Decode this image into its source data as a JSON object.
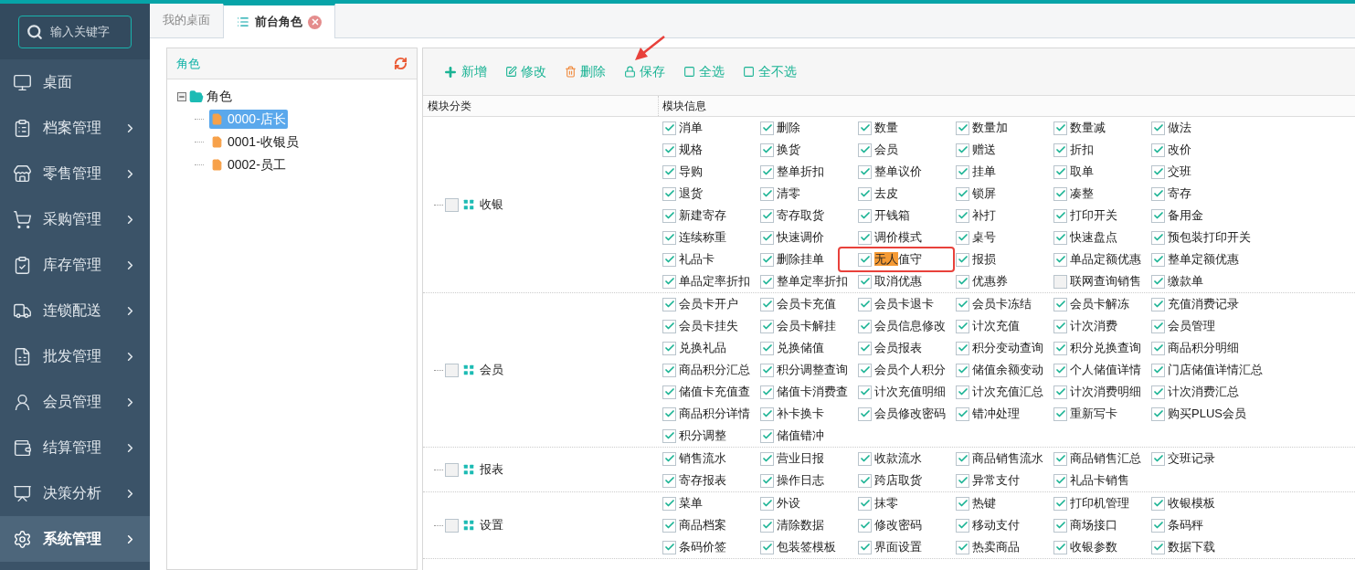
{
  "search": {
    "placeholder": "输入关键字"
  },
  "sidebar": {
    "items": [
      {
        "label": "桌面",
        "has_submenu": false,
        "selected": false
      },
      {
        "label": "档案管理",
        "has_submenu": true,
        "selected": false
      },
      {
        "label": "零售管理",
        "has_submenu": true,
        "selected": false
      },
      {
        "label": "采购管理",
        "has_submenu": true,
        "selected": false
      },
      {
        "label": "库存管理",
        "has_submenu": true,
        "selected": false
      },
      {
        "label": "连锁配送",
        "has_submenu": true,
        "selected": false
      },
      {
        "label": "批发管理",
        "has_submenu": true,
        "selected": false
      },
      {
        "label": "会员管理",
        "has_submenu": true,
        "selected": false
      },
      {
        "label": "结算管理",
        "has_submenu": true,
        "selected": false
      },
      {
        "label": "决策分析",
        "has_submenu": true,
        "selected": false
      },
      {
        "label": "系统管理",
        "has_submenu": true,
        "selected": true
      }
    ]
  },
  "tabs": [
    {
      "label": "我的桌面",
      "selected": false,
      "closable": false
    },
    {
      "label": "前台角色",
      "selected": true,
      "closable": true
    }
  ],
  "role_panel": {
    "title": "角色",
    "tree": {
      "label": "角色",
      "expanded": true,
      "children": [
        {
          "label": "0000-店长",
          "selected": true
        },
        {
          "label": "0001-收银员",
          "selected": false
        },
        {
          "label": "0002-员工",
          "selected": false
        }
      ]
    }
  },
  "toolbar": [
    {
      "label": "新增",
      "kind": "add",
      "annotated": false
    },
    {
      "label": "修改",
      "kind": "edit",
      "annotated": false
    },
    {
      "label": "删除",
      "kind": "delete",
      "annotated": false
    },
    {
      "label": "保存",
      "kind": "save",
      "annotated": true
    },
    {
      "label": "全选",
      "kind": "select",
      "annotated": false
    },
    {
      "label": "全不选",
      "kind": "select",
      "annotated": false
    }
  ],
  "table": {
    "columns": [
      "模块分类",
      "模块信息"
    ],
    "groups": [
      {
        "category": "收银",
        "checked": false,
        "permissions": [
          {
            "label": "消单",
            "checked": true
          },
          {
            "label": "删除",
            "checked": true
          },
          {
            "label": "数量",
            "checked": true
          },
          {
            "label": "数量加",
            "checked": true
          },
          {
            "label": "数量减",
            "checked": true
          },
          {
            "label": "做法",
            "checked": true
          },
          {
            "label": "规格",
            "checked": true
          },
          {
            "label": "换货",
            "checked": true
          },
          {
            "label": "会员",
            "checked": true
          },
          {
            "label": "赠送",
            "checked": true
          },
          {
            "label": "折扣",
            "checked": true
          },
          {
            "label": "改价",
            "checked": true
          },
          {
            "label": "导购",
            "checked": true
          },
          {
            "label": "整单折扣",
            "checked": true
          },
          {
            "label": "整单议价",
            "checked": true
          },
          {
            "label": "挂单",
            "checked": true
          },
          {
            "label": "取单",
            "checked": true
          },
          {
            "label": "交班",
            "checked": true
          },
          {
            "label": "退货",
            "checked": true
          },
          {
            "label": "清零",
            "checked": true
          },
          {
            "label": "去皮",
            "checked": true
          },
          {
            "label": "锁屏",
            "checked": true
          },
          {
            "label": "凑整",
            "checked": true
          },
          {
            "label": "寄存",
            "checked": true
          },
          {
            "label": "新建寄存",
            "checked": true
          },
          {
            "label": "寄存取货",
            "checked": true
          },
          {
            "label": "开钱箱",
            "checked": true
          },
          {
            "label": "补打",
            "checked": true
          },
          {
            "label": "打印开关",
            "checked": true
          },
          {
            "label": "备用金",
            "checked": true
          },
          {
            "label": "连续称重",
            "checked": true
          },
          {
            "label": "快速调价",
            "checked": true
          },
          {
            "label": "调价模式",
            "checked": true
          },
          {
            "label": "桌号",
            "checked": true
          },
          {
            "label": "快速盘点",
            "checked": true
          },
          {
            "label": "预包装打印开关",
            "checked": true
          },
          {
            "label": "礼品卡",
            "checked": true
          },
          {
            "label": "删除挂单",
            "checked": true
          },
          {
            "checked": true,
            "annotated": true,
            "label_parts": [
              {
                "text": "无人",
                "highlighted": true
              },
              {
                "text": "值守",
                "highlighted": false
              }
            ]
          },
          {
            "label": "报损",
            "checked": true
          },
          {
            "label": "单品定额优惠",
            "checked": true
          },
          {
            "label": "整单定额优惠",
            "checked": true
          },
          {
            "label": "单品定率折扣",
            "checked": true
          },
          {
            "label": "整单定率折扣",
            "checked": true
          },
          {
            "label": "取消优惠",
            "checked": true
          },
          {
            "label": "优惠券",
            "checked": true
          },
          {
            "label": "联网查询销售",
            "checked": false
          },
          {
            "label": "缴款单",
            "checked": true
          }
        ]
      },
      {
        "category": "会员",
        "checked": false,
        "permissions": [
          {
            "label": "会员卡开户",
            "checked": true
          },
          {
            "label": "会员卡充值",
            "checked": true
          },
          {
            "label": "会员卡退卡",
            "checked": true
          },
          {
            "label": "会员卡冻结",
            "checked": true
          },
          {
            "label": "会员卡解冻",
            "checked": true
          },
          {
            "label": "充值消费记录",
            "checked": true
          },
          {
            "label": "会员卡挂失",
            "checked": true
          },
          {
            "label": "会员卡解挂",
            "checked": true
          },
          {
            "label": "会员信息修改",
            "checked": true
          },
          {
            "label": "计次充值",
            "checked": true
          },
          {
            "label": "计次消费",
            "checked": true
          },
          {
            "label": "会员管理",
            "checked": true
          },
          {
            "label": "兑换礼品",
            "checked": true
          },
          {
            "label": "兑换储值",
            "checked": true
          },
          {
            "label": "会员报表",
            "checked": true
          },
          {
            "label": "积分变动查询",
            "checked": true
          },
          {
            "label": "积分兑换查询",
            "checked": true
          },
          {
            "label": "商品积分明细",
            "checked": true
          },
          {
            "label": "商品积分汇总",
            "checked": true
          },
          {
            "label": "积分调整查询",
            "checked": true
          },
          {
            "label": "会员个人积分",
            "checked": true
          },
          {
            "label": "储值余额变动",
            "checked": true
          },
          {
            "label": "个人储值详情",
            "checked": true
          },
          {
            "label": "门店储值详情汇总",
            "checked": true
          },
          {
            "label": "储值卡充值查",
            "checked": true
          },
          {
            "label": "储值卡消费查",
            "checked": true
          },
          {
            "label": "计次充值明细",
            "checked": true
          },
          {
            "label": "计次充值汇总",
            "checked": true
          },
          {
            "label": "计次消费明细",
            "checked": true
          },
          {
            "label": "计次消费汇总",
            "checked": true
          },
          {
            "label": "商品积分详情",
            "checked": true
          },
          {
            "label": "补卡换卡",
            "checked": true
          },
          {
            "label": "会员修改密码",
            "checked": true
          },
          {
            "label": "错冲处理",
            "checked": true
          },
          {
            "label": "重新写卡",
            "checked": true
          },
          {
            "label": "购买PLUS会员",
            "checked": true
          },
          {
            "label": "积分调整",
            "checked": true
          },
          {
            "label": "储值错冲",
            "checked": true
          }
        ]
      },
      {
        "category": "报表",
        "checked": false,
        "permissions": [
          {
            "label": "销售流水",
            "checked": true
          },
          {
            "label": "营业日报",
            "checked": true
          },
          {
            "label": "收款流水",
            "checked": true
          },
          {
            "label": "商品销售流水",
            "checked": true
          },
          {
            "label": "商品销售汇总",
            "checked": true
          },
          {
            "label": "交班记录",
            "checked": true
          },
          {
            "label": "寄存报表",
            "checked": true
          },
          {
            "label": "操作日志",
            "checked": true
          },
          {
            "label": "跨店取货",
            "checked": true
          },
          {
            "label": "异常支付",
            "checked": true
          },
          {
            "label": "礼品卡销售",
            "checked": true
          }
        ]
      },
      {
        "category": "设置",
        "checked": false,
        "permissions": [
          {
            "label": "菜单",
            "checked": true
          },
          {
            "label": "外设",
            "checked": true
          },
          {
            "label": "抹零",
            "checked": true
          },
          {
            "label": "热键",
            "checked": true
          },
          {
            "label": "打印机管理",
            "checked": true
          },
          {
            "label": "收银模板",
            "checked": true
          },
          {
            "label": "商品档案",
            "checked": true
          },
          {
            "label": "清除数据",
            "checked": true
          },
          {
            "label": "修改密码",
            "checked": true
          },
          {
            "label": "移动支付",
            "checked": true
          },
          {
            "label": "商场接口",
            "checked": true
          },
          {
            "label": "条码秤",
            "checked": true
          },
          {
            "label": "条码价签",
            "checked": true
          },
          {
            "label": "包装签模板",
            "checked": true
          },
          {
            "label": "界面设置",
            "checked": true
          },
          {
            "label": "热卖商品",
            "checked": true
          },
          {
            "label": "收银参数",
            "checked": true
          },
          {
            "label": "数据下载",
            "checked": true
          }
        ]
      }
    ]
  }
}
